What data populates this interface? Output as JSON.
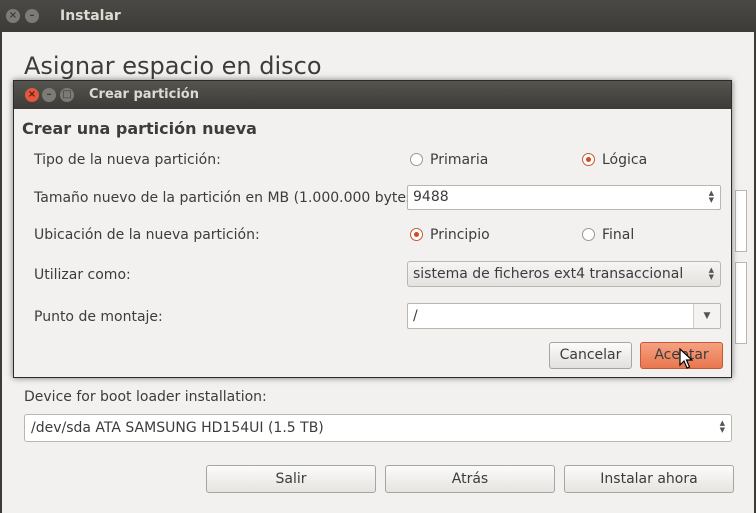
{
  "main_window": {
    "title": "Instalar",
    "heading": "Asignar espacio en disco",
    "bootloader_label": "Device for boot loader installation:",
    "bootloader_value": "/dev/sda ATA SAMSUNG HD154UI (1.5 TB)",
    "buttons": {
      "quit": "Salir",
      "back": "Atrás",
      "install": "Instalar ahora"
    }
  },
  "dialog": {
    "title": "Crear partición",
    "heading": "Crear una partición nueva",
    "type": {
      "label": "Tipo de la nueva partición:",
      "options": [
        {
          "label": "Primaria",
          "selected": false
        },
        {
          "label": "Lógica",
          "selected": true
        }
      ]
    },
    "size": {
      "label": "Tamaño nuevo de la partición en MB (1.000.000 bytes):",
      "value": "9488"
    },
    "location": {
      "label": "Ubicación de la nueva partición:",
      "options": [
        {
          "label": "Principio",
          "selected": true
        },
        {
          "label": "Final",
          "selected": false
        }
      ]
    },
    "use_as": {
      "label": "Utilizar como:",
      "value": "sistema de ficheros ext4 transaccional"
    },
    "mount_point": {
      "label": "Punto de montaje:",
      "value": "/"
    },
    "buttons": {
      "cancel": "Cancelar",
      "ok": "Aceptar"
    }
  },
  "colors": {
    "accent": "#dd4814",
    "titlebar": "#3c3b37",
    "window_bg": "#f2f1f0",
    "ok_button": "#e8764f"
  },
  "icons": {
    "close": "close-icon",
    "minimize": "minimize-icon",
    "maximize": "maximize-icon",
    "dropdown": "chevron-down-icon",
    "spinner": "spin-arrows-icon",
    "cursor": "mouse-pointer-icon"
  }
}
